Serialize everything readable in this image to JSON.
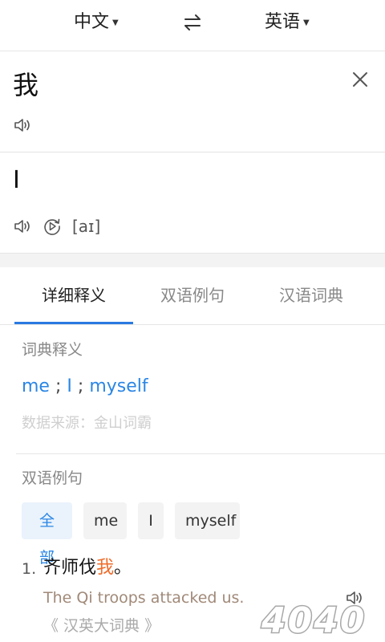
{
  "header": {
    "source_lang": "中文",
    "target_lang": "英语"
  },
  "source": {
    "text": "我"
  },
  "result": {
    "text": "I",
    "phonetic": "[aɪ]"
  },
  "tabs": [
    {
      "label": "详细释义",
      "active": true
    },
    {
      "label": "双语例句",
      "active": false
    },
    {
      "label": "汉语词典",
      "active": false
    }
  ],
  "dictionary": {
    "title": "词典释义",
    "definitions": [
      "me",
      "I",
      "myself"
    ],
    "separator": ";",
    "source": "数据来源：金山词霸"
  },
  "examples": {
    "title": "双语例句",
    "filters": [
      "全部",
      "me",
      "I",
      "myself"
    ],
    "active_filter": "全部",
    "items": [
      {
        "number": "1.",
        "zh_before": "齐师伐",
        "zh_highlight": "我",
        "zh_after": "。",
        "en": "The Qi troops attacked us.",
        "source": "《 汉英大词典 》"
      }
    ]
  },
  "watermark": {
    "text": "4040"
  },
  "colors": {
    "accent": "#2a86e5",
    "tab_indicator": "#2a7ae2",
    "highlight": "#ef6c2a",
    "example_en": "#a08978"
  }
}
